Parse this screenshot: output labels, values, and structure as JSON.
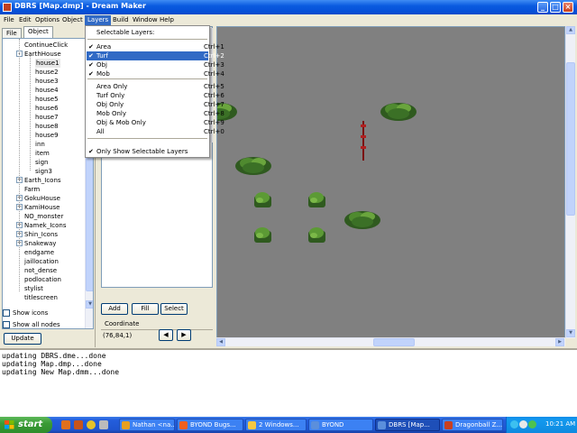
{
  "window": {
    "title": "DBRS [Map.dmp] - Dream Maker",
    "minimize": "_",
    "maximize": "□",
    "close": "×"
  },
  "menubar": [
    "File",
    "Edit",
    "Options",
    "Object",
    "Layers",
    "Build",
    "Window",
    "Help"
  ],
  "left_tabs": [
    "File",
    "Object"
  ],
  "tree": [
    {
      "label": "ContinueClick",
      "indent": 1,
      "expander": ""
    },
    {
      "label": "EarthHouse",
      "indent": 1,
      "expander": "-"
    },
    {
      "label": "house1",
      "indent": 2,
      "expander": "",
      "state": "selected"
    },
    {
      "label": "house2",
      "indent": 2,
      "expander": ""
    },
    {
      "label": "house3",
      "indent": 2,
      "expander": ""
    },
    {
      "label": "house4",
      "indent": 2,
      "expander": ""
    },
    {
      "label": "house5",
      "indent": 2,
      "expander": ""
    },
    {
      "label": "house6",
      "indent": 2,
      "expander": ""
    },
    {
      "label": "house7",
      "indent": 2,
      "expander": ""
    },
    {
      "label": "house8",
      "indent": 2,
      "expander": ""
    },
    {
      "label": "house9",
      "indent": 2,
      "expander": ""
    },
    {
      "label": "inn",
      "indent": 2,
      "expander": ""
    },
    {
      "label": "item",
      "indent": 2,
      "expander": ""
    },
    {
      "label": "sign",
      "indent": 2,
      "expander": ""
    },
    {
      "label": "sign3",
      "indent": 2,
      "expander": ""
    },
    {
      "label": "Earth_Icons",
      "indent": 1,
      "expander": "+"
    },
    {
      "label": "Farm",
      "indent": 1,
      "expander": ""
    },
    {
      "label": "GokuHouse",
      "indent": 1,
      "expander": "+"
    },
    {
      "label": "KamiHouse",
      "indent": 1,
      "expander": "+"
    },
    {
      "label": "NO_monster",
      "indent": 1,
      "expander": ""
    },
    {
      "label": "Namek_Icons",
      "indent": 1,
      "expander": "+"
    },
    {
      "label": "Shin_Icons",
      "indent": 1,
      "expander": "+"
    },
    {
      "label": "Snakeway",
      "indent": 1,
      "expander": "+"
    },
    {
      "label": "endgame",
      "indent": 1,
      "expander": ""
    },
    {
      "label": "jaillocation",
      "indent": 1,
      "expander": ""
    },
    {
      "label": "not_dense",
      "indent": 1,
      "expander": ""
    },
    {
      "label": "podlocation",
      "indent": 1,
      "expander": ""
    },
    {
      "label": "stylist",
      "indent": 1,
      "expander": ""
    },
    {
      "label": "titlescreen",
      "indent": 1,
      "expander": ""
    }
  ],
  "options": {
    "show_icons": "Show icons",
    "show_all_nodes": "Show all nodes",
    "update": "Update"
  },
  "buttons": {
    "add": "Add",
    "fill": "Fill",
    "select": "Select"
  },
  "coordinate": {
    "label": "Coordinate",
    "value": "(76,84,1)",
    "prev": "◀",
    "next": "▶"
  },
  "layers_menu": {
    "header": "Selectable Layers:",
    "items": [
      {
        "label": "Area",
        "shortcut": "Ctrl+1",
        "checked": "✔",
        "state": ""
      },
      {
        "label": "Turf",
        "shortcut": "Ctrl+2",
        "checked": "✔",
        "state": "hover"
      },
      {
        "label": "Obj",
        "shortcut": "Ctrl+3",
        "checked": "✔",
        "state": ""
      },
      {
        "label": "Mob",
        "shortcut": "Ctrl+4",
        "checked": "✔",
        "state": ""
      },
      {
        "label": "Area Only",
        "shortcut": "Ctrl+5",
        "checked": "",
        "state": ""
      },
      {
        "label": "Turf Only",
        "shortcut": "Ctrl+6",
        "checked": "",
        "state": ""
      },
      {
        "label": "Obj Only",
        "shortcut": "Ctrl+7",
        "checked": "",
        "state": ""
      },
      {
        "label": "Mob Only",
        "shortcut": "Ctrl+8",
        "checked": "",
        "state": ""
      },
      {
        "label": "Obj & Mob Only",
        "shortcut": "Ctrl+9",
        "checked": "",
        "state": ""
      },
      {
        "label": "All",
        "shortcut": "Ctrl+0",
        "checked": "",
        "state": ""
      },
      {
        "label": "Only Show Selectable Layers",
        "shortcut": "",
        "checked": "✔",
        "state": ""
      }
    ]
  },
  "output": [
    "updating DBRS.dme...done",
    "updating Map.dmp...done",
    "updating New Map.dmm...done"
  ],
  "taskbar": {
    "start": "start",
    "tasks": [
      {
        "label": "Nathan <na...",
        "active": false
      },
      {
        "label": "BYOND Bugs...",
        "active": false
      },
      {
        "label": "2 Windows...",
        "active": false
      },
      {
        "label": "BYOND",
        "active": false
      },
      {
        "label": "DBRS [Map...",
        "active": true
      },
      {
        "label": "Dragonball Z...",
        "active": false
      }
    ],
    "clock": "10:21 AM"
  },
  "colors": {
    "map_bg": "#808080",
    "selection": "#316ac5",
    "taskbar": "#245edc",
    "start": "#3a9b35"
  }
}
